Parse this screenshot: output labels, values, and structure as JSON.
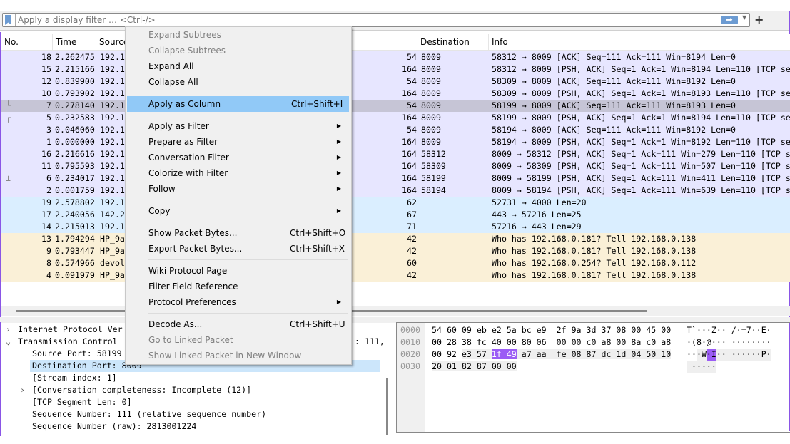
{
  "filter": {
    "placeholder": "Apply a display filter … <Ctrl-/>",
    "apply_icon": "arrow-right-icon",
    "add_label": "+"
  },
  "columns": [
    "No.",
    "Time",
    "Source",
    "Destination Port",
    "Info"
  ],
  "packets": [
    {
      "no": "18",
      "time": "2.262475",
      "source": "192.1",
      "length": "54",
      "dport": "8009",
      "info": "58312 → 8009 [ACK] Seq=111 Ack=111 Win=8194 Len=0",
      "type": "tcp"
    },
    {
      "no": "15",
      "time": "2.215166",
      "source": "192.1",
      "length": "164",
      "dport": "8009",
      "info": "58312 → 8009 [PSH, ACK] Seq=1 Ack=1 Win=8194 Len=110 [TCP se",
      "type": "tcp"
    },
    {
      "no": "12",
      "time": "0.839900",
      "source": "192.1",
      "length": "54",
      "dport": "8009",
      "info": "58309 → 8009 [ACK] Seq=111 Ack=111 Win=8192 Len=0",
      "type": "tcp"
    },
    {
      "no": "10",
      "time": "0.793902",
      "source": "192.1",
      "length": "164",
      "dport": "8009",
      "info": "58309 → 8009 [PSH, ACK] Seq=1 Ack=1 Win=8193 Len=110 [TCP se",
      "type": "tcp"
    },
    {
      "no": "7",
      "time": "0.278140",
      "source": "192.1",
      "length": "54",
      "dport": "8009",
      "info": "58199 → 8009 [ACK] Seq=111 Ack=111 Win=8193 Len=0",
      "type": "sel",
      "mark": "└"
    },
    {
      "no": "5",
      "time": "0.232583",
      "source": "192.1",
      "length": "164",
      "dport": "8009",
      "info": "58199 → 8009 [PSH, ACK] Seq=1 Ack=1 Win=8194 Len=110 [TCP se",
      "type": "tcp",
      "mark": "┌"
    },
    {
      "no": "3",
      "time": "0.046060",
      "source": "192.1",
      "length": "54",
      "dport": "8009",
      "info": "58194 → 8009 [ACK] Seq=111 Ack=111 Win=8192 Len=0",
      "type": "tcp"
    },
    {
      "no": "1",
      "time": "0.000000",
      "source": "192.1",
      "length": "164",
      "dport": "8009",
      "info": "58194 → 8009 [PSH, ACK] Seq=1 Ack=1 Win=8192 Len=110 [TCP se",
      "type": "tcp"
    },
    {
      "no": "16",
      "time": "2.216616",
      "source": "192.1",
      "length": "164",
      "dport": "58312",
      "info": "8009 → 58312 [PSH, ACK] Seq=1 Ack=111 Win=279 Len=110 [TCP s",
      "type": "tcp"
    },
    {
      "no": "11",
      "time": "0.795593",
      "source": "192.1",
      "length": "164",
      "dport": "58309",
      "info": "8009 → 58309 [PSH, ACK] Seq=1 Ack=111 Win=507 Len=110 [TCP s",
      "type": "tcp"
    },
    {
      "no": "6",
      "time": "0.234017",
      "source": "192.1",
      "length": "164",
      "dport": "58199",
      "info": "8009 → 58199 [PSH, ACK] Seq=1 Ack=111 Win=411 Len=110 [TCP s",
      "type": "tcp",
      "mark": "⊥"
    },
    {
      "no": "2",
      "time": "0.001759",
      "source": "192.1",
      "length": "164",
      "dport": "58194",
      "info": "8009 → 58194 [PSH, ACK] Seq=1 Ack=111 Win=639 Len=110 [TCP s",
      "type": "tcp"
    },
    {
      "no": "19",
      "time": "2.578802",
      "source": "192.1",
      "length": "62",
      "dport": "",
      "info": "52731 → 4000 Len=20",
      "type": "udp"
    },
    {
      "no": "17",
      "time": "2.240056",
      "source": "142.2",
      "length": "67",
      "dport": "",
      "info": "443 → 57216 Len=25",
      "type": "udp"
    },
    {
      "no": "14",
      "time": "2.215013",
      "source": "192.1",
      "length": "71",
      "dport": "",
      "info": "57216 → 443 Len=29",
      "type": "udp"
    },
    {
      "no": "13",
      "time": "1.794294",
      "source": "HP_9a",
      "length": "42",
      "dport": "",
      "info": "Who has 192.168.0.181? Tell 192.168.0.138",
      "type": "arp"
    },
    {
      "no": "9",
      "time": "0.793447",
      "source": "HP_9a",
      "length": "42",
      "dport": "",
      "info": "Who has 192.168.0.181? Tell 192.168.0.138",
      "type": "arp"
    },
    {
      "no": "8",
      "time": "0.574966",
      "source": "devol",
      "length": "60",
      "dport": "",
      "info": "Who has 192.168.0.254? Tell 192.168.0.112",
      "type": "arp"
    },
    {
      "no": "4",
      "time": "0.091979",
      "source": "HP_9a",
      "length": "42",
      "dport": "",
      "info": "Who has 192.168.0.181? Tell 192.168.0.138",
      "type": "arp"
    }
  ],
  "row_colors": {
    "tcp": "#e7e6ff",
    "udp": "#daeeff",
    "arp": "#faf0d7",
    "selected": "#c6c5d6"
  },
  "details": [
    {
      "text": "Internet Protocol Ver",
      "indent": 0,
      "toggle": "collapsed"
    },
    {
      "text": "Transmission Control",
      "tail": ": 111,",
      "indent": 0,
      "toggle": "expanded"
    },
    {
      "text": "Source Port: 58199",
      "indent": 1
    },
    {
      "text": "Destination Port: 8009",
      "indent": 1,
      "selected": true
    },
    {
      "text": "[Stream index: 1]",
      "indent": 1
    },
    {
      "text": "[Conversation completeness: Incomplete (12)]",
      "indent": 1,
      "toggle": "collapsed"
    },
    {
      "text": "[TCP Segment Len: 0]",
      "indent": 1
    },
    {
      "text": "Sequence Number: 111    (relative sequence number)",
      "indent": 1
    },
    {
      "text": "Sequence Number (raw): 2813001224",
      "indent": 1
    }
  ],
  "hex": {
    "rows": [
      {
        "offset": "0000",
        "bytes": [
          "54",
          "60",
          "09",
          "eb",
          "e2",
          "5a",
          "bc",
          "e9",
          "2f",
          "9a",
          "3d",
          "37",
          "08",
          "00",
          "45",
          "00"
        ],
        "ascii": "T`···Z·· /·=7··E·"
      },
      {
        "offset": "0010",
        "bytes": [
          "00",
          "28",
          "38",
          "fc",
          "40",
          "00",
          "80",
          "06",
          "00",
          "00",
          "c0",
          "a8",
          "00",
          "8a",
          "c0",
          "a8"
        ],
        "ascii": "·(8·@··· ········"
      },
      {
        "offset": "0020",
        "bytes": [
          "00",
          "92",
          "e3",
          "57",
          "1f",
          "49",
          "a7",
          "aa",
          "fe",
          "08",
          "87",
          "dc",
          "1d",
          "04",
          "50",
          "10"
        ],
        "ascii": "···W·I·· ······P·"
      },
      {
        "offset": "0030",
        "bytes": [
          "20",
          "01",
          "82",
          "87",
          "00",
          "00"
        ],
        "ascii": " ·····"
      }
    ],
    "tcp_header_bytes": [
      34,
      54
    ],
    "selected_field_bytes": [
      36,
      38
    ],
    "selected_color": "#9b5cf5"
  },
  "context_menu": [
    {
      "label": "Expand Subtrees",
      "disabled": true
    },
    {
      "label": "Collapse Subtrees",
      "disabled": true
    },
    {
      "label": "Expand All"
    },
    {
      "label": "Collapse All"
    },
    {
      "sep": true
    },
    {
      "label": "Apply as Column",
      "shortcut": "Ctrl+Shift+I",
      "highlighted": true
    },
    {
      "sep": true
    },
    {
      "label": "Apply as Filter",
      "submenu": true
    },
    {
      "label": "Prepare as Filter",
      "submenu": true
    },
    {
      "label": "Conversation Filter",
      "submenu": true
    },
    {
      "label": "Colorize with Filter",
      "submenu": true
    },
    {
      "label": "Follow",
      "submenu": true
    },
    {
      "sep": true
    },
    {
      "label": "Copy",
      "submenu": true
    },
    {
      "sep": true
    },
    {
      "label": "Show Packet Bytes...",
      "shortcut": "Ctrl+Shift+O"
    },
    {
      "label": "Export Packet Bytes...",
      "shortcut": "Ctrl+Shift+X"
    },
    {
      "sep": true
    },
    {
      "label": "Wiki Protocol Page"
    },
    {
      "label": "Filter Field Reference"
    },
    {
      "label": "Protocol Preferences",
      "submenu": true
    },
    {
      "sep": true
    },
    {
      "label": "Decode As...",
      "shortcut": "Ctrl+Shift+U"
    },
    {
      "label": "Go to Linked Packet",
      "disabled": true
    },
    {
      "label": "Show Linked Packet in New Window",
      "disabled": true
    }
  ]
}
